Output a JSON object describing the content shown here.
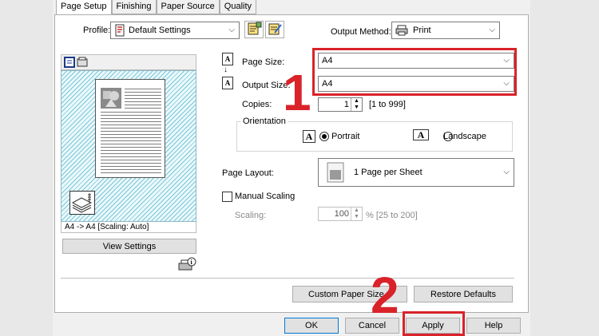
{
  "tabs": [
    {
      "label": "Page Setup",
      "active": true
    },
    {
      "label": "Finishing"
    },
    {
      "label": "Paper Source"
    },
    {
      "label": "Quality"
    }
  ],
  "profile": {
    "label": "Profile:",
    "value": "Default Settings"
  },
  "output_method": {
    "label": "Output Method:",
    "value": "Print"
  },
  "page_size": {
    "label": "Page Size:",
    "value": "A4"
  },
  "output_size": {
    "label": "Output Size:",
    "value": "A4"
  },
  "copies": {
    "label": "Copies:",
    "value": "1",
    "range": "[1 to 999]"
  },
  "orientation": {
    "label": "Orientation",
    "portrait": "Portrait",
    "landscape": "Landscape",
    "selected": "Portrait"
  },
  "page_layout": {
    "label": "Page Layout:",
    "value": "1 Page per Sheet"
  },
  "manual_scaling": {
    "label": "Manual Scaling",
    "checked": false
  },
  "scaling": {
    "label": "Scaling:",
    "value": "100",
    "range": "% [25 to 200]"
  },
  "preview": {
    "status": "A4 -> A4 [Scaling: Auto]"
  },
  "buttons": {
    "view_settings": "View Settings",
    "custom_paper_size": "Custom Paper Size...",
    "restore_defaults": "Restore Defaults",
    "ok": "OK",
    "cancel": "Cancel",
    "apply": "Apply",
    "help": "Help"
  },
  "annotations": {
    "step1": "1",
    "step2": "2"
  },
  "colors": {
    "highlight": "#d9222a",
    "preview_hatch": "#7cc7d9"
  },
  "icons": {
    "profile": "profile-icon",
    "output_method": "printer-icon",
    "page_size": "page-size-icon",
    "output_size": "output-size-icon",
    "portrait": "portrait-icon",
    "landscape": "landscape-icon",
    "page_layout": "page-layout-icon",
    "view_toggle": "preview-view-icon",
    "printer_info": "printer-info-icon"
  }
}
